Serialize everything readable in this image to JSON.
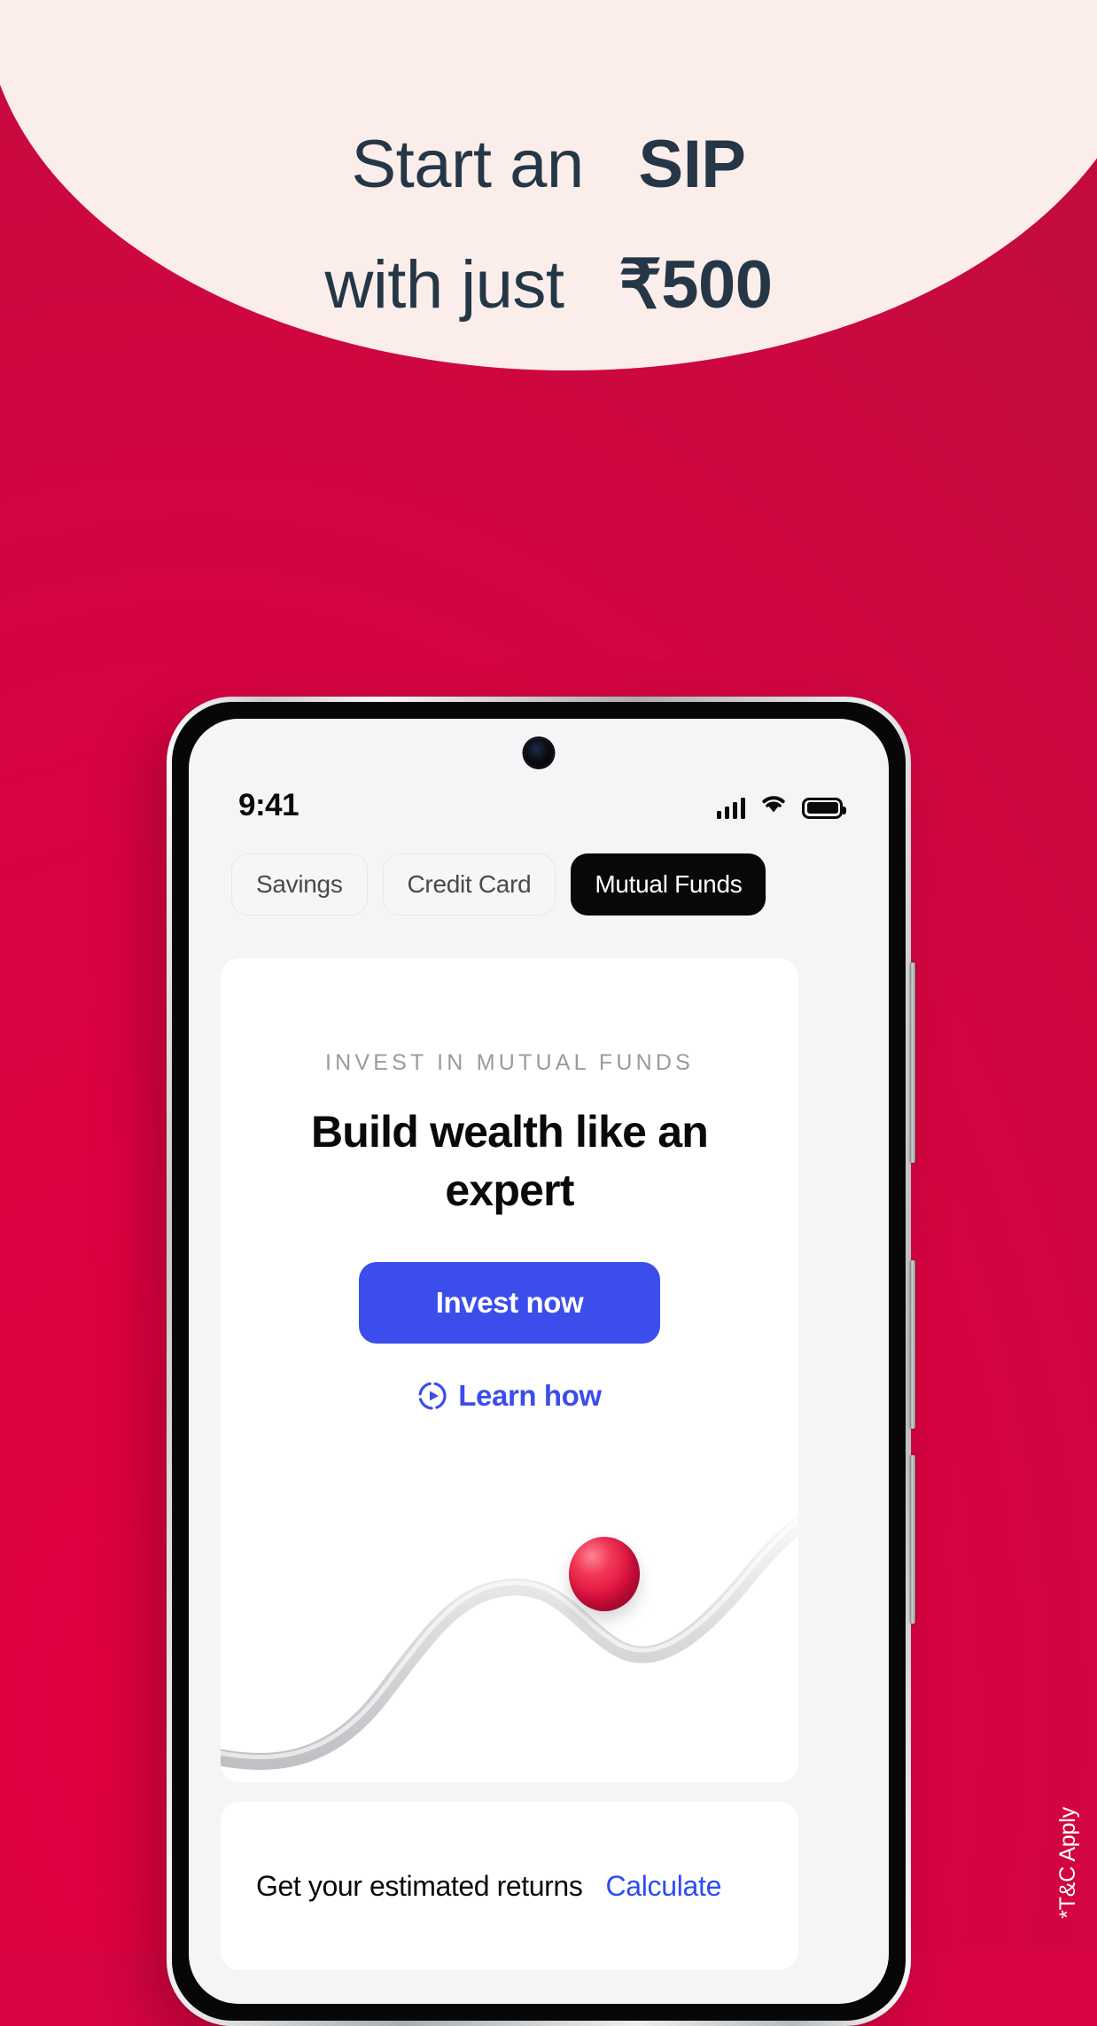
{
  "hero": {
    "line1_light": "Start an",
    "line1_bold": "SIP",
    "line2_light": "with just",
    "line2_bold": "₹500",
    "shape_color": "#FBEDEA",
    "text_color": "#253746"
  },
  "background": {
    "color": "#D80443",
    "accent": "#E0003F"
  },
  "footnote": {
    "text": "*T&C Apply"
  },
  "phone": {
    "status_bar": {
      "time": "9:41",
      "signal_icon": "cellular-signal-icon",
      "wifi_icon": "wifi-icon",
      "battery_icon": "battery-full-icon"
    },
    "camera_icon": "front-camera-icon",
    "earpiece_icon": "earpiece-speaker-icon",
    "tabs": [
      {
        "label": "Savings",
        "active": false
      },
      {
        "label": "Credit Card",
        "active": false
      },
      {
        "label": "Mutual Funds",
        "active": true
      }
    ],
    "main_card": {
      "eyebrow": "INVEST IN MUTUAL FUNDS",
      "title": "Build wealth like an expert",
      "primary_button": "Invest now",
      "learn_link": "Learn how",
      "learn_icon": "play-circle-dashed-icon",
      "accent_color": "#3B4DEB",
      "art": {
        "curve_icon": "growth-curve-graphic",
        "ball_icon": "red-sphere-graphic",
        "ball_color": "#E01140",
        "curve_color": "#D3D4D6"
      }
    },
    "bottom_card": {
      "label": "Get your estimated returns",
      "action": "Calculate",
      "action_color": "#2D4BF5"
    }
  }
}
